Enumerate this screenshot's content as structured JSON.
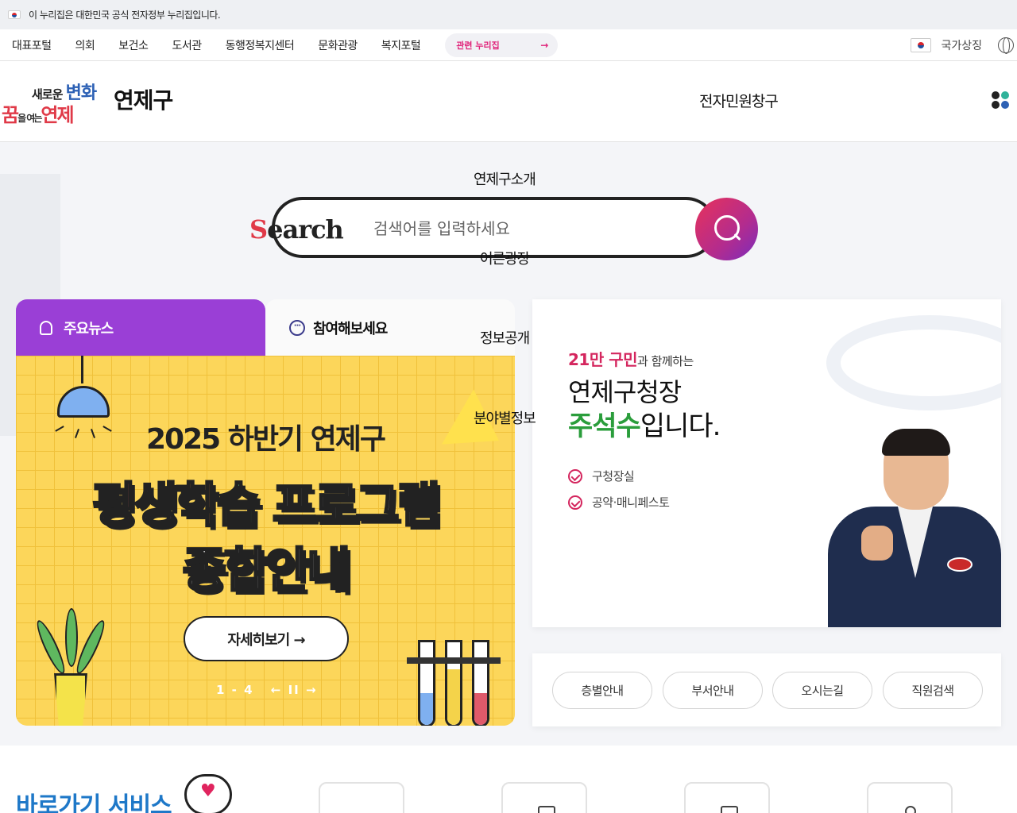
{
  "gov_banner": {
    "text": "이 누리집은 대한민국 공식 전자정부 누리집입니다."
  },
  "top_nav": {
    "items": [
      "대표포털",
      "의회",
      "보건소",
      "도서관",
      "동행정복지센터",
      "문화관광",
      "복지포털"
    ],
    "related_label": "관련 누리집",
    "national_symbol": "국가상징"
  },
  "header": {
    "logo_line1_a": "새로운 ",
    "logo_line1_b": "변화",
    "logo_line2_a": "꿈",
    "logo_line2_b": "을 여는",
    "logo_line2_c": "연제",
    "brand": "연제구",
    "e_civil": "전자민원창구",
    "all_menu_colors": [
      "#222222",
      "#2fb39a",
      "#2d61b5",
      "#e03a48"
    ]
  },
  "nav_overlay": [
    "연제구소개",
    "어른광장",
    "정보공개",
    "분야별정보"
  ],
  "search": {
    "word_first": "S",
    "word_rest": "earch",
    "placeholder": "검색어를 입력하세요"
  },
  "tabs": {
    "news": "주요뉴스",
    "participate": "참여해보세요"
  },
  "banner": {
    "year": "2025 하반기 연제구",
    "main_1": "평",
    "main_2": "생",
    "main_3": "학",
    "main_4": "습",
    "main_5": " 프로그램",
    "sub": "종합안내",
    "more": "자세히보기 →",
    "pager": "1 - 4",
    "pager_controls": "← II →"
  },
  "mayor": {
    "pop_bold": "21만 구민",
    "pop_rest": "과 함께하는",
    "title": "연제구청장",
    "name": "주석수",
    "name_suffix": "입니다.",
    "links": [
      "구청장실",
      "공약·매니페스토"
    ]
  },
  "quick_buttons": [
    "층별안내",
    "부서안내",
    "오시는길",
    "직원검색"
  ],
  "bottom": {
    "title": "바로가기 서비스"
  },
  "colors": {
    "accent_purple": "#9a3fd6",
    "accent_pink": "#d4265e",
    "accent_green": "#2a9d3b",
    "accent_blue": "#1e78c8"
  }
}
